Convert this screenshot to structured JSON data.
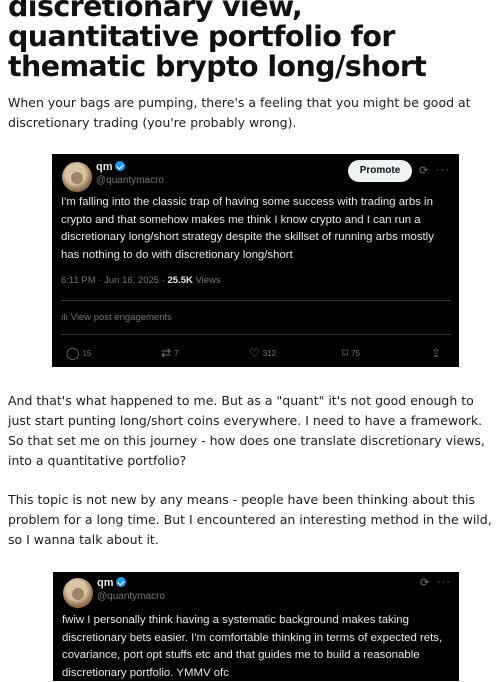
{
  "article": {
    "title": "discretionary view, quantitative portfolio for thematic brypto long/short",
    "para1": "When your bags are pumping, there's a feeling that you might be good at discretionary trading (you're probably wrong).",
    "para2": "And that's what happened to me. But as a \"quant\" it's not good enough to just start punting long/short coins everywhere. I need to have a framework. So that set me on this journey - how does one translate discretionary views, into a quantitative portfolio?",
    "para3": "This topic is not new by any means - people have been thinking about this problem for a long time. But I encountered an interesting method in the wild, so I wanna talk about it."
  },
  "tweet1": {
    "name": "qm",
    "handle": "@quantymacro",
    "promote_label": "Promote",
    "text": "I'm falling into the classic trap of having some success with trading arbs in crypto and that somehow makes me think I know crypto and I can run a discretionary long/short strategy despite the skillset of running arbs mostly has nothing to do with discretionary long/short",
    "timestamp": "6:11 PM · Jun 16, 2025 · ",
    "views_count": "25.5K",
    "views_label": " Views",
    "engagements_label": "View post engagements",
    "replies": "15",
    "reposts": "7",
    "likes": "312",
    "bookmarks": "75"
  },
  "tweet2": {
    "name": "qm",
    "handle": "@quantymacro",
    "text": "fwiw I personally think having a systematic background makes taking discretionary bets easier. I'm comfortable thinking in terms of expected rets, covariance, port opt stuffs etc and that guides me to build a reasonable discretionary portfolio. YMMV ofc"
  },
  "colors": {
    "tweet_bg": "#000000",
    "tweet_text": "#e7e9ea",
    "muted": "#71767b",
    "verified": "#1d9bf0"
  }
}
